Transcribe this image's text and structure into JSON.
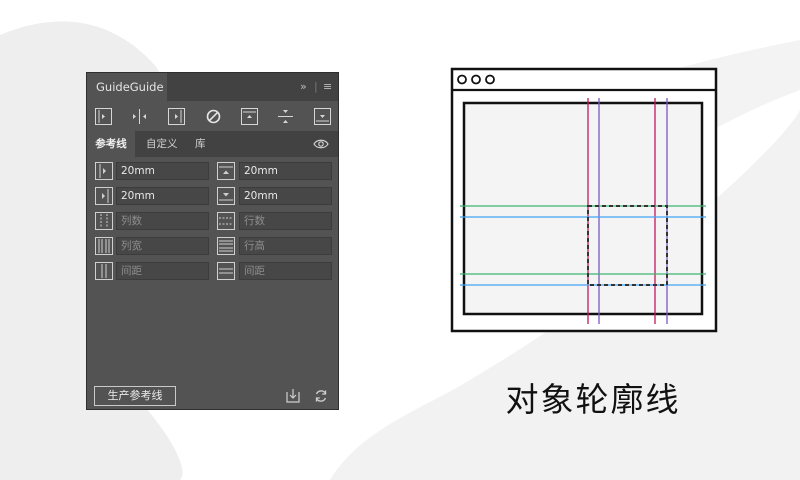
{
  "panel": {
    "title": "GuideGuide",
    "toolbar": [
      {
        "icon": "left-edge-guide-icon"
      },
      {
        "icon": "vertical-midpoint-guide-icon"
      },
      {
        "icon": "right-edge-guide-icon"
      },
      {
        "icon": "clear-guides-icon"
      },
      {
        "icon": "top-edge-guide-icon"
      },
      {
        "icon": "horizontal-midpoint-guide-icon"
      },
      {
        "icon": "bottom-edge-guide-icon"
      }
    ],
    "tabs": [
      {
        "label": "参考线",
        "active": true
      },
      {
        "label": "自定义",
        "active": false
      },
      {
        "label": "库",
        "active": false
      }
    ],
    "fields": {
      "left_margin": {
        "value": "20mm",
        "placeholder": ""
      },
      "top_margin": {
        "value": "20mm",
        "placeholder": ""
      },
      "right_margin": {
        "value": "20mm",
        "placeholder": ""
      },
      "bottom_margin": {
        "value": "20mm",
        "placeholder": ""
      },
      "columns": {
        "value": "",
        "placeholder": "列数"
      },
      "rows": {
        "value": "",
        "placeholder": "行数"
      },
      "column_width": {
        "value": "",
        "placeholder": "列宽"
      },
      "row_height": {
        "value": "",
        "placeholder": "行高"
      },
      "column_gutter": {
        "value": "",
        "placeholder": "间距"
      },
      "row_gutter": {
        "value": "",
        "placeholder": "间距"
      }
    },
    "generate_button": "生产参考线"
  },
  "caption": "对象轮廓线",
  "colors": {
    "panel_bg": "#535353",
    "panel_header": "#424242",
    "vertical_guide_red": "#c2185b",
    "vertical_guide_purple": "#7e57c2",
    "horizontal_guide_green": "#3cb371",
    "horizontal_guide_blue": "#42a5f5"
  }
}
